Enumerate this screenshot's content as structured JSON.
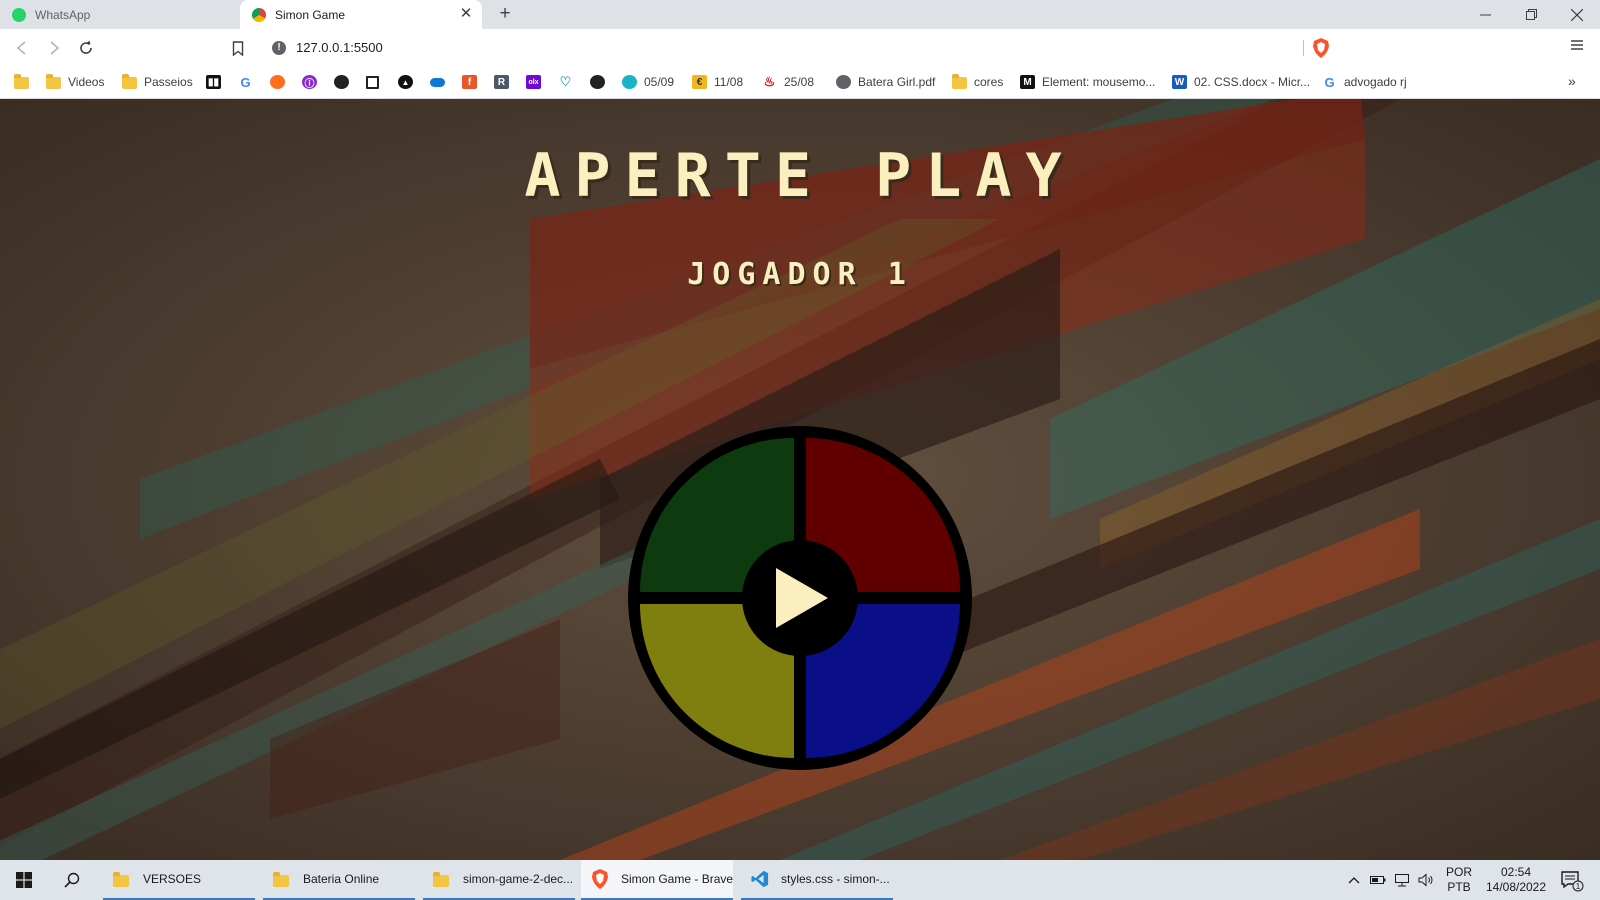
{
  "browser": {
    "tabs": [
      {
        "title": "WhatsApp",
        "icon": "whatsapp-icon",
        "active": false
      },
      {
        "title": "Simon Game",
        "icon": "chrome-globe-icon",
        "active": true
      }
    ],
    "address": "127.0.0.1:5500",
    "bookmarks": [
      {
        "label": "",
        "icon": "folder-icon"
      },
      {
        "label": "Videos",
        "icon": "folder-icon"
      },
      {
        "label": "Passeios",
        "icon": "folder-icon"
      },
      {
        "label": "",
        "icon": "trello-icon"
      },
      {
        "label": "",
        "icon": "google-icon"
      },
      {
        "label": "",
        "icon": "sun-icon"
      },
      {
        "label": "",
        "icon": "purple-circle-icon"
      },
      {
        "label": "",
        "icon": "github-icon"
      },
      {
        "label": "",
        "icon": "square-icon"
      },
      {
        "label": "",
        "icon": "triangle-icon"
      },
      {
        "label": "",
        "icon": "onedrive-icon"
      },
      {
        "label": "",
        "icon": "orange-f-icon"
      },
      {
        "label": "",
        "icon": "r-icon"
      },
      {
        "label": "",
        "icon": "olx-icon"
      },
      {
        "label": "",
        "icon": "heart-outline-icon"
      },
      {
        "label": "",
        "icon": "github-icon"
      },
      {
        "label": "05/09",
        "icon": "teal-smile-icon"
      },
      {
        "label": "11/08",
        "icon": "yellow-badge-icon"
      },
      {
        "label": "25/08",
        "icon": "santander-icon"
      },
      {
        "label": "Batera Girl.pdf",
        "icon": "globe-icon"
      },
      {
        "label": "cores",
        "icon": "folder-icon"
      },
      {
        "label": "Element: mousemo...",
        "icon": "mdn-icon"
      },
      {
        "label": "02. CSS.docx - Micr...",
        "icon": "word-icon"
      },
      {
        "label": "advogado rj",
        "icon": "google-icon"
      }
    ]
  },
  "game": {
    "title": "APERTE PLAY",
    "player": "JOGADOR 1",
    "pads": [
      {
        "name": "green",
        "color": "#0e3a10"
      },
      {
        "name": "red",
        "color": "#600000"
      },
      {
        "name": "yellow",
        "color": "#7f7f0f"
      },
      {
        "name": "blue",
        "color": "#0a0f88"
      }
    ],
    "play_color": "#fbefc0"
  },
  "taskbar": {
    "apps": [
      {
        "label": "VERSOES",
        "icon": "folder-icon"
      },
      {
        "label": "Bateria Online",
        "icon": "folder-icon"
      },
      {
        "label": "simon-game-2-dec...",
        "icon": "folder-icon"
      },
      {
        "label": "Simon Game - Brave",
        "icon": "brave-icon"
      },
      {
        "label": "styles.css - simon-...",
        "icon": "vscode-icon"
      }
    ],
    "lang_1": "POR",
    "lang_2": "PTB",
    "time": "02:54",
    "date": "14/08/2022",
    "notification_count": "1"
  }
}
